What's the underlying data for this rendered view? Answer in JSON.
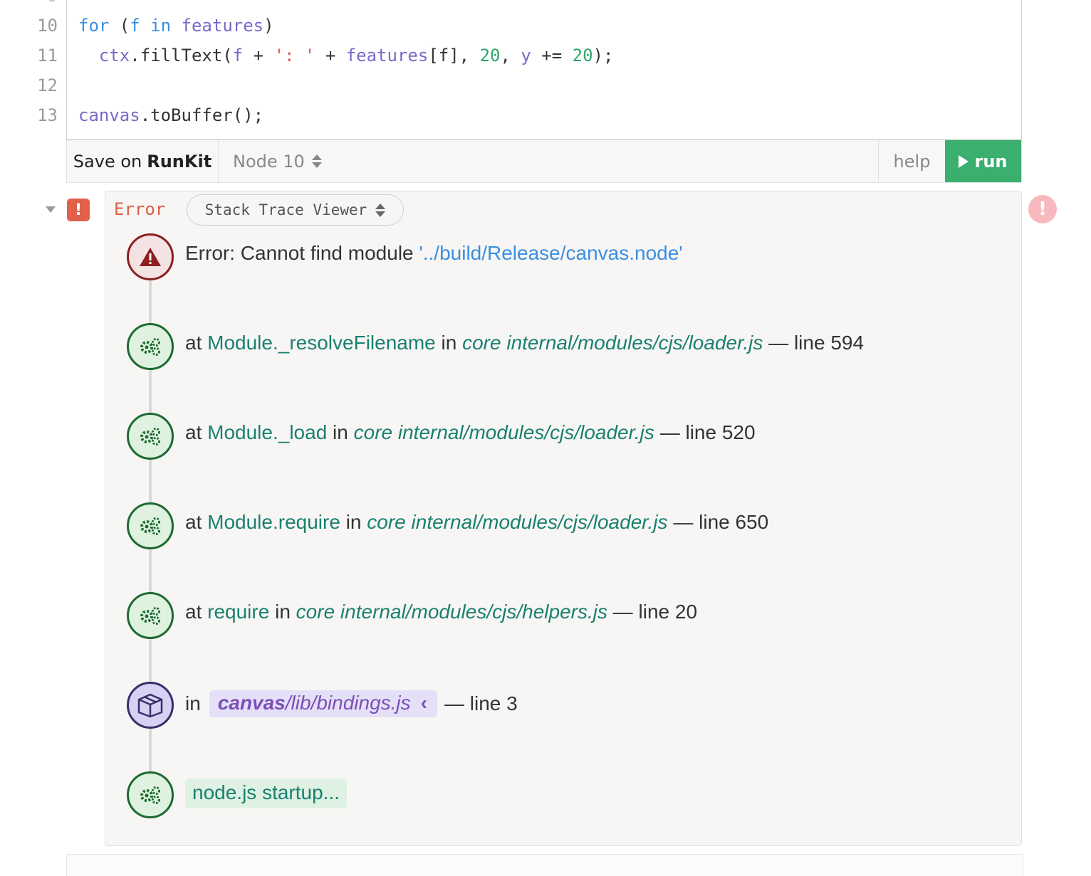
{
  "editor": {
    "lines": [
      {
        "num": "10",
        "tokens": [
          {
            "t": "for",
            "c": "kw"
          },
          {
            "t": " (",
            "c": "plain"
          },
          {
            "t": "f",
            "c": "kw"
          },
          {
            "t": " ",
            "c": "plain"
          },
          {
            "t": "in",
            "c": "kw"
          },
          {
            "t": " ",
            "c": "plain"
          },
          {
            "t": "features",
            "c": "var"
          },
          {
            "t": ")",
            "c": "plain"
          }
        ]
      },
      {
        "num": "11",
        "tokens": [
          {
            "t": "  ",
            "c": "plain"
          },
          {
            "t": "ctx",
            "c": "var"
          },
          {
            "t": ".fillText(",
            "c": "plain"
          },
          {
            "t": "f",
            "c": "var"
          },
          {
            "t": " + ",
            "c": "plain"
          },
          {
            "t": "': '",
            "c": "str"
          },
          {
            "t": " + ",
            "c": "plain"
          },
          {
            "t": "features",
            "c": "var"
          },
          {
            "t": "[f], ",
            "c": "plain"
          },
          {
            "t": "20",
            "c": "num"
          },
          {
            "t": ", ",
            "c": "plain"
          },
          {
            "t": "y",
            "c": "var"
          },
          {
            "t": " += ",
            "c": "plain"
          },
          {
            "t": "20",
            "c": "num"
          },
          {
            "t": ");",
            "c": "plain"
          }
        ]
      },
      {
        "num": "12",
        "tokens": []
      },
      {
        "num": "13",
        "tokens": [
          {
            "t": "canvas",
            "c": "var"
          },
          {
            "t": ".toBuffer();",
            "c": "plain"
          }
        ]
      }
    ]
  },
  "toolbar": {
    "save_prefix": "Save on",
    "save_brand": "RunKit",
    "node_version": "Node 10",
    "help_label": "help",
    "run_label": "run"
  },
  "output": {
    "error_badge": "!",
    "error_label": "Error",
    "viewer_label": "Stack Trace Viewer",
    "side_badge": "!"
  },
  "trace": {
    "error": {
      "prefix": "Error: Cannot find module ",
      "module": "'../build/Release/canvas.node'"
    },
    "frames": [
      {
        "fn": "Module._resolveFilename",
        "file": "core internal/modules/cjs/loader.js",
        "line": "— line 594"
      },
      {
        "fn": "Module._load",
        "file": "core internal/modules/cjs/loader.js",
        "line": "— line 520"
      },
      {
        "fn": "Module.require",
        "file": "core internal/modules/cjs/loader.js",
        "line": "— line 650"
      },
      {
        "fn": "require",
        "file": "core internal/modules/cjs/helpers.js",
        "line": "— line 20"
      }
    ],
    "at_word": "at",
    "in_word": "in",
    "package_frame": {
      "in_word": "in",
      "pkg": "canvas",
      "path": "/lib/bindings.js",
      "chevron": "‹",
      "line": "— line 3"
    },
    "startup": "node.js startup..."
  },
  "icons": {
    "error_node": "warning-triangle-icon",
    "core_node": "gears-icon",
    "package_node": "package-box-icon"
  },
  "colors": {
    "run_green": "#3aaf6e",
    "error_red": "#d9604a",
    "link_blue": "#3b8ee0",
    "frame_green": "#1a8070",
    "package_purple": "#7c4fb8"
  }
}
